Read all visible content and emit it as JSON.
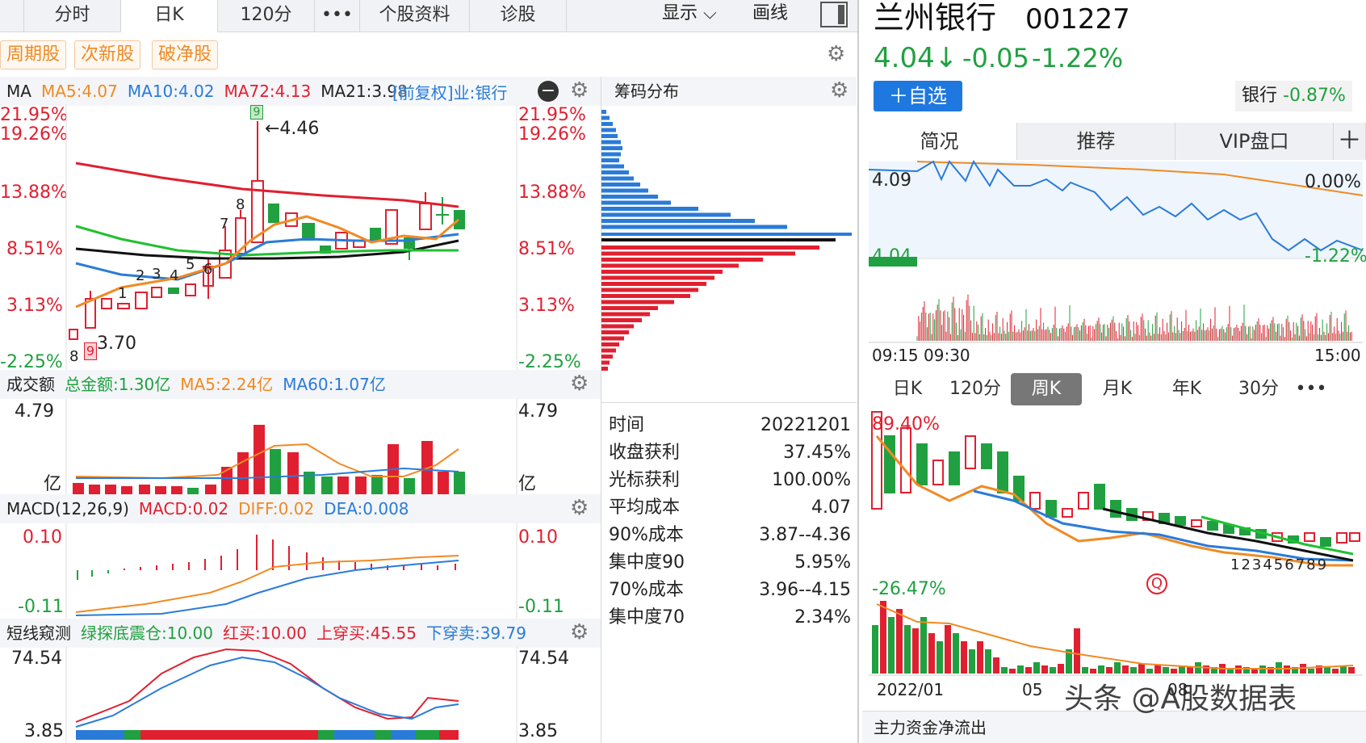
{
  "top_tabs": [
    "分时",
    "日K",
    "120分",
    "•••",
    "个股资料",
    "诊股"
  ],
  "display_label": "显示",
  "draw_label": "画线",
  "tags": [
    "周期股",
    "次新股",
    "破净股"
  ],
  "ma_header": {
    "name": "MA",
    "ma5": "MA5:4.07",
    "ma10": "MA10:4.02",
    "ma72": "MA72:4.13",
    "ma21": "MA21:3.98",
    "overlay": "[前复权]业:银行"
  },
  "price_axis": [
    "21.95%",
    "19.26%",
    "13.88%",
    "8.51%",
    "3.13%",
    "-2.25%"
  ],
  "kline_annot": {
    "high": "←4.46",
    "low": "3.70",
    "nums": [
      "8",
      "9",
      "1",
      "2",
      "3",
      "4",
      "5",
      "6",
      "7",
      "8",
      "9"
    ],
    "flag9": "9"
  },
  "chip": {
    "title": "筹码分布",
    "stats": [
      [
        "时间",
        "20221201"
      ],
      [
        "收盘获利",
        "37.45%"
      ],
      [
        "光标获利",
        "100.00%"
      ],
      [
        "平均成本",
        "4.07"
      ],
      [
        "90%成本",
        "3.87--4.36"
      ],
      [
        "集中度90",
        "5.95%"
      ],
      [
        "70%成本",
        "3.96--4.15"
      ],
      [
        "集中度70",
        "2.34%"
      ]
    ]
  },
  "volume": {
    "title": "成交额",
    "total": "总金额:1.30亿",
    "ma5": "MA5:2.24亿",
    "ma60": "MA60:1.07亿",
    "top": "4.79",
    "unit": "亿"
  },
  "macd": {
    "title": "MACD(12,26,9)",
    "macd": "MACD:0.02",
    "diff": "DIFF:0.02",
    "dea": "DEA:0.008",
    "top": "0.10",
    "bottom": "-0.11"
  },
  "short": {
    "title": "短线窥测",
    "g": "绿探底震仓:10.00",
    "r": "红买:10.00",
    "up": "上穿买:45.55",
    "down": "下穿卖:39.79",
    "top": "74.54",
    "bottom": "3.85"
  },
  "stock": {
    "name": "兰州银行",
    "code": "001227",
    "price": "4.04↓",
    "change": "-0.05",
    "pct": "-1.22%",
    "add": "＋自选",
    "industry": "银行",
    "industry_pct": "-0.87%"
  },
  "right_tabs": [
    "简况",
    "推荐",
    "VIP盘口",
    "＋"
  ],
  "minute": {
    "high": "4.09",
    "low": "4.04",
    "pct_high": "0.00%",
    "pct_low": "-1.22%",
    "t1": "09:15",
    "t2": "09:30",
    "t3": "15:00"
  },
  "period_tabs": [
    "日K",
    "120分",
    "周K",
    "月K",
    "年K",
    "30分",
    "•••"
  ],
  "weekly": {
    "top": "89.40%",
    "bottom": "-26.47%",
    "x1": "2022/01",
    "x2": "05",
    "x3": "08",
    "q": "Q",
    "nums": "123456789",
    "flag": "9"
  },
  "bottom_label": "主力资金净流出",
  "watermark": "头条 @A股数据表"
}
